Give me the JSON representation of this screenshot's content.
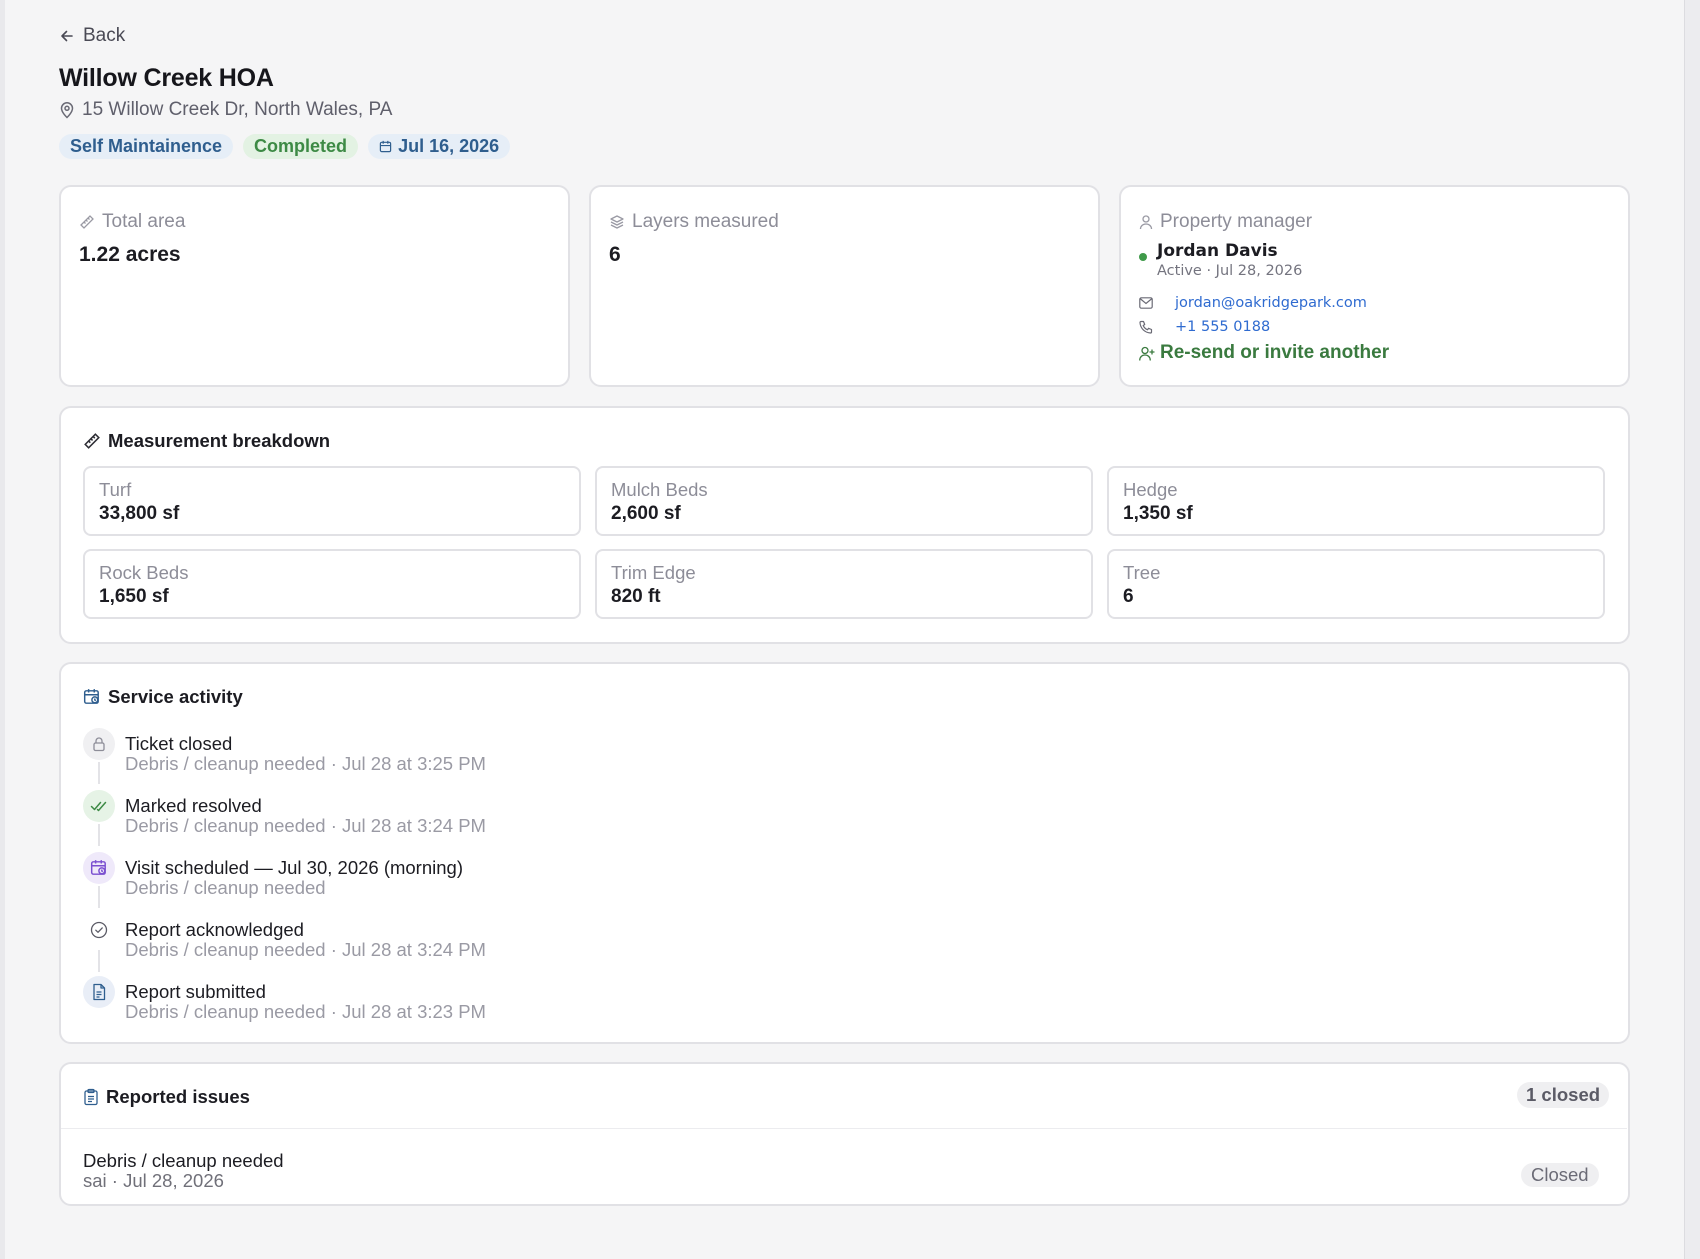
{
  "nav": {
    "back_label": "Back"
  },
  "property": {
    "name": "Willow Creek HOA",
    "address": "15 Willow Creek Dr, North Wales, PA",
    "tags": {
      "type": "Self Maintainence",
      "status": "Completed",
      "date": "Jul 16, 2026"
    }
  },
  "stats": {
    "total_area": {
      "label": "Total area",
      "value": "1.22 acres"
    },
    "layers": {
      "label": "Layers measured",
      "value": "6"
    }
  },
  "manager": {
    "label": "Property manager",
    "name": "Jordan Davis",
    "status": "Active · Jul 28, 2026",
    "email": "jordan@oakridgepark.com",
    "phone": "+1 555 0188",
    "resend_label": "Re-send or invite another"
  },
  "breakdown": {
    "title": "Measurement breakdown",
    "items": [
      {
        "label": "Turf",
        "value": "33,800 sf"
      },
      {
        "label": "Mulch Beds",
        "value": "2,600 sf"
      },
      {
        "label": "Hedge",
        "value": "1,350 sf"
      },
      {
        "label": "Rock Beds",
        "value": "1,650 sf"
      },
      {
        "label": "Trim Edge",
        "value": "820 ft"
      },
      {
        "label": "Tree",
        "value": "6"
      }
    ]
  },
  "activity": {
    "title": "Service activity",
    "items": [
      {
        "icon": "lock-icon",
        "title": "Ticket closed",
        "subtitle": "Debris / cleanup needed · Jul 28 at 3:25 PM"
      },
      {
        "icon": "double-check-icon",
        "title": "Marked resolved",
        "subtitle": "Debris / cleanup needed · Jul 28 at 3:24 PM"
      },
      {
        "icon": "calendar-clock-icon",
        "title": "Visit scheduled — Jul 30, 2026 (morning)",
        "subtitle": "Debris / cleanup needed"
      },
      {
        "icon": "check-circle-icon",
        "title": "Report acknowledged",
        "subtitle": "Debris / cleanup needed · Jul 28 at 3:24 PM"
      },
      {
        "icon": "document-icon",
        "title": "Report submitted",
        "subtitle": "Debris / cleanup needed · Jul 28 at 3:23 PM"
      }
    ]
  },
  "issues": {
    "title": "Reported issues",
    "count": "1 closed",
    "items": [
      {
        "title": "Debris / cleanup needed",
        "meta": "sai · Jul 28, 2026",
        "status": "Closed"
      }
    ]
  },
  "colors": {
    "accent_green": "#3a7a3f",
    "link_blue": "#2f6bd0",
    "tag_blue": "#2f5e8e",
    "status_green": "#3d8a45"
  }
}
